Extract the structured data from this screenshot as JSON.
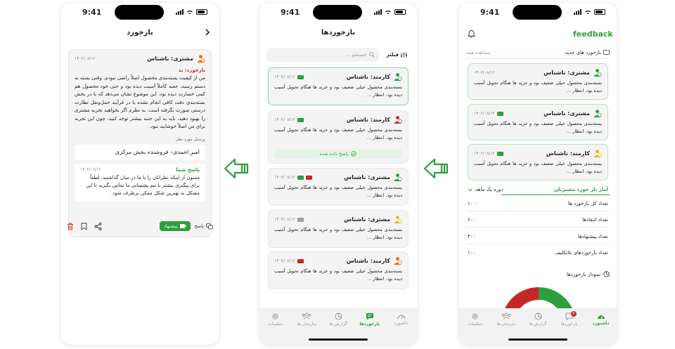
{
  "status": {
    "time": "9:41"
  },
  "detail": {
    "title": "بازخورد",
    "customer": "مشتری: ناشناس",
    "date": "۱۴۰۲/۰۸/۱۲",
    "feedback_label": "بازخورد: بد",
    "feedback_text": "من از کیفیت بسته‌بندی محصول اصلاً راضی نبودم. وقتی بسته به دستم رسید، جعبه کاملاً آسیب دیده بود و حتی خود محصول هم کمی خسارت دیده بود. این موضوع نشان می‌دهد که یا در بخش بسته‌بندی دقت کافی انجام نشده یا در فرآیند حمل‌ونقل نظارت درستی صورت نگرفته است. به نظرم اگر بخواهید تجربه مشتری را بهبود دهید، باید به این جنبه بیشتر توجه کنید، چون این تجربه برای من اصلاً خوشایند نبود.",
    "target_label": "پرسنل مورد نظر",
    "target_value": "امیر احمدی– فروشنده بخش مرکزی",
    "reply_label": "پاسخ شما",
    "reply_date": "۱۴۰۲/۰۸/۱۲",
    "reply_text": "ممنون از اینکه نظراتان را با ما در میان گذاشتید. لطفاً برای پیگیری بیشتر با تیم پشتیبانی ما تماس بگیرید تا این مشکل به بهترین شکل ممکن برطرف شود.",
    "reply_button": "پاسخ",
    "suggest_button": "پیشنهاد"
  },
  "list": {
    "title": "بازخوردها",
    "filter_label": "فیلتر",
    "search_placeholder": "جستجو ...",
    "answered_label": "پاسخ داده شده",
    "cards": [
      {
        "name": "کارمند: ناشناس",
        "date": "۱۴۰۲/۰۸/۱۲",
        "text": "بسته‌بندی محصول خیلی ضعیف بود و خرید ها هنگام تحویل آسیب دیده بود. انتظار ...",
        "person": "green",
        "tags": [
          "#2e9e3e"
        ]
      },
      {
        "name": "کارمند: ناشناس",
        "date": "۱۴۰۲/۰۸/۱۲",
        "text": "بسته‌بندی محصول خیلی ضعیف بود و خرید ها هنگام تحویل آسیب دیده بود. انتظار ...",
        "person": "red",
        "tags": [
          "#2e9e3e"
        ]
      },
      {
        "name": "مشتری: ناشناس",
        "date": "۱۴۰۲/۰۸/۱۲",
        "text": "بسته‌بندی محصول خیلی ضعیف بود و خرید ها هنگام تحویل آسیب دیده بود. انتظار ...",
        "person": "green",
        "tags": [
          "#c62828",
          "#2e9e3e"
        ]
      },
      {
        "name": "مشتری: ناشناس",
        "date": "۱۴۰۲/۰۸/۱۲",
        "text": "بسته‌بندی محصول خیلی ضعیف بود و خرید ها هنگام تحویل آسیب دیده بود. انتظار ...",
        "person": "yellow",
        "tags": [
          "#9e9e9e"
        ]
      },
      {
        "name": "کارمند: ناشناس",
        "date": "۱۴۰۲/۰۸/۱۲",
        "text": "بسته‌بندی محصول خیلی ضعیف بود و خرید ها هنگام تحویل آسیب دیده بود. انتظار ...",
        "person": "orange",
        "tags": [
          "#c62828"
        ]
      }
    ]
  },
  "tabs": [
    {
      "label": "داشبورد",
      "icon": "gauge-icon"
    },
    {
      "label": "بازخوردها",
      "icon": "chat-icon"
    },
    {
      "label": "گزارش ها",
      "icon": "pie-icon"
    },
    {
      "label": "دپارتمان ها",
      "icon": "group-icon"
    },
    {
      "label": "تنظیمات",
      "icon": "gear-icon"
    }
  ],
  "dashboard": {
    "logo": "feedback",
    "new_section": "بازخورد های جدید",
    "see_all": "مشاهده همه",
    "cards": [
      {
        "name": "مشتری: ناشناس",
        "date": "۱۴۰۲/۰۸/۱۲",
        "text": "بسته‌بندی محصول خیلی ضعیف بود و خرید ها هنگام تحویل آسیب دیده بود. انتظار ...",
        "person": "green"
      },
      {
        "name": "مشتری: ناشناس",
        "date": "۱۴۰۲/۰۸/۱۲",
        "text": "بسته‌بندی محصول خیلی ضعیف بود و خرید ها هنگام تحویل آسیب دیده بود. انتظار ...",
        "person": "green"
      },
      {
        "name": "کارمند: ناشناس",
        "date": "۱۴۰۲/۰۸/۱۲",
        "text": "بسته‌بندی محصول خیلی ضعیف بود و خرید ها هنگام تحویل آسیب دیده بود. انتظار ...",
        "person": "yellow"
      }
    ],
    "stats_title": "آمار باز خورد مشتریان",
    "period": "دوره یک ماهه",
    "stats": [
      {
        "label": "تعداد کل بازخورد ها",
        "value": "۱۰۰۰"
      },
      {
        "label": "تعداد انتقادها",
        "value": "۶۰۰"
      },
      {
        "label": "تعداد پیشنهادها",
        "value": "۳۰۰"
      },
      {
        "label": "تعداد بازخوردهای بلاتکلیف",
        "value": "۱۰۰"
      }
    ],
    "chart_label": "نمودار بازخوردها",
    "badge": "۳",
    "gauge": {
      "green": 0.5,
      "red": 0.4,
      "orange": 0.1
    }
  },
  "colors": {
    "green": "#2e9e3e",
    "red": "#c62828",
    "yellow": "#f2b01e",
    "orange": "#ef6c00"
  }
}
